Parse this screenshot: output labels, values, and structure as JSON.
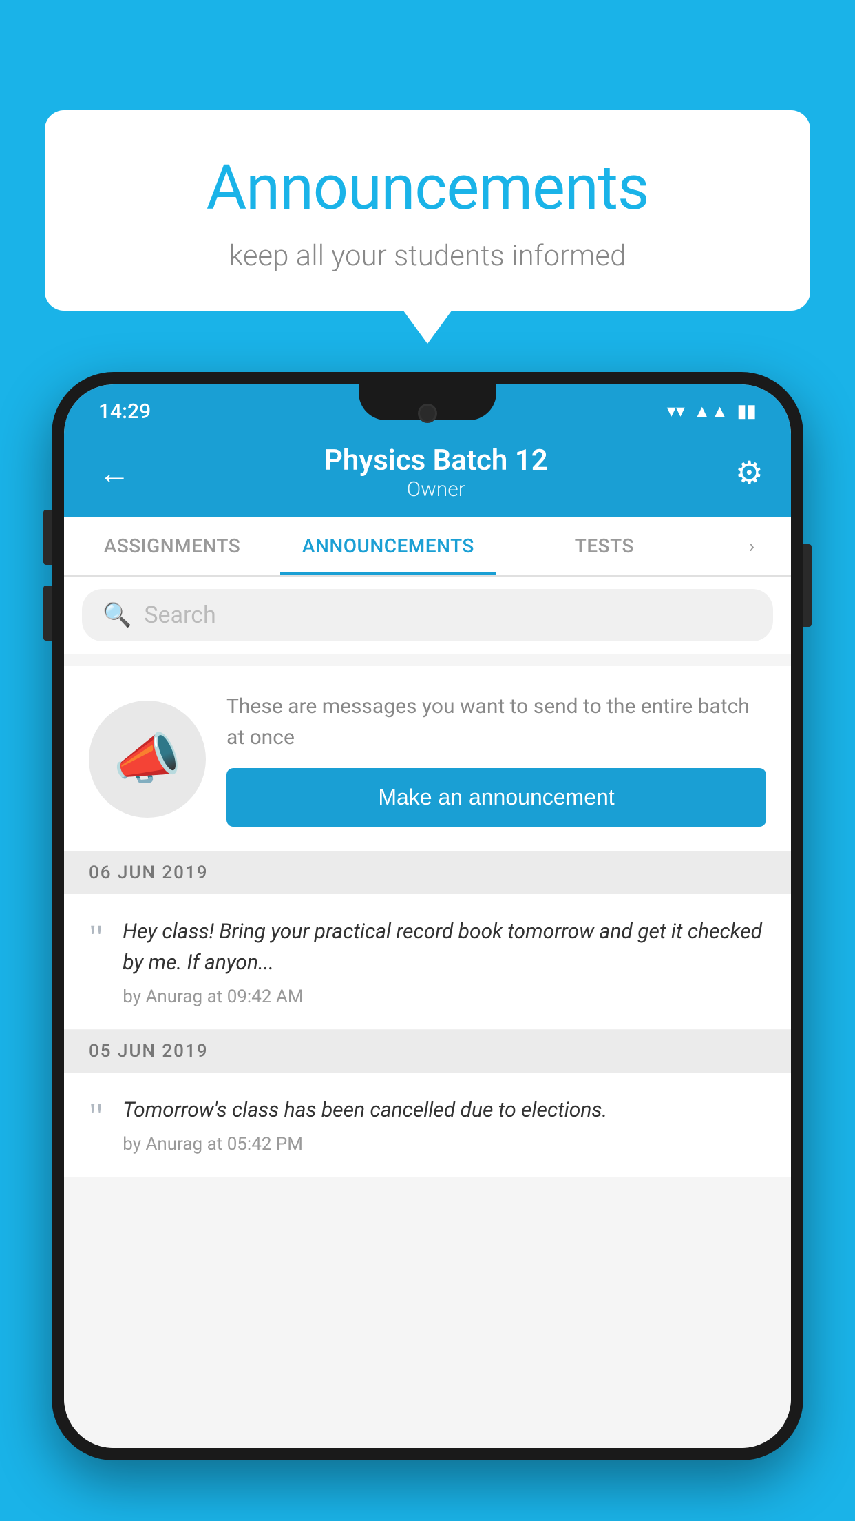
{
  "background_color": "#1ab3e8",
  "speech_bubble": {
    "title": "Announcements",
    "subtitle": "keep all your students informed"
  },
  "phone": {
    "status_bar": {
      "time": "14:29",
      "icons": [
        "wifi",
        "signal",
        "battery"
      ]
    },
    "header": {
      "back_label": "←",
      "title": "Physics Batch 12",
      "subtitle": "Owner",
      "gear_label": "⚙"
    },
    "tabs": [
      {
        "label": "ASSIGNMENTS",
        "active": false
      },
      {
        "label": "ANNOUNCEMENTS",
        "active": true
      },
      {
        "label": "TESTS",
        "active": false
      }
    ],
    "search": {
      "placeholder": "Search"
    },
    "announcement_placeholder": {
      "description": "These are messages you want to send to the entire batch at once",
      "button_label": "Make an announcement"
    },
    "date_sections": [
      {
        "date": "06  JUN  2019",
        "items": [
          {
            "message": "Hey class! Bring your practical record book tomorrow and get it checked by me. If anyon...",
            "meta": "by Anurag at 09:42 AM"
          }
        ]
      },
      {
        "date": "05  JUN  2019",
        "items": [
          {
            "message": "Tomorrow's class has been cancelled due to elections.",
            "meta": "by Anurag at 05:42 PM"
          }
        ]
      }
    ]
  }
}
